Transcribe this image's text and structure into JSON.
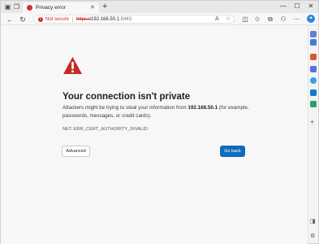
{
  "browser": {
    "tab_title": "Privacy error",
    "new_tab_icon": "+",
    "address": {
      "security_label": "Not secure",
      "scheme": "https://",
      "host": "192.168.50.1",
      "port": ":8443"
    }
  },
  "page": {
    "heading": "Your connection isn't private",
    "desc_before": "Attackers might be trying to steal your information from ",
    "desc_host": "192.168.50.1",
    "desc_after": " (for example, passwords, messages, or credit cards).",
    "error_code": "NET::ERR_CERT_AUTHORITY_INVALID",
    "advanced_label": "Advanced",
    "go_back_label": "Go back"
  },
  "colors": {
    "warning_red": "#c62828",
    "primary_blue": "#0f6cbd"
  },
  "icons": [
    "workspaces-icon",
    "tab-actions-icon",
    "back-icon",
    "refresh-icon",
    "read-aloud-icon",
    "favorites-star-icon",
    "split-screen-icon",
    "collections-icon",
    "extensions-icon",
    "copilot-icon",
    "warning-triangle-icon"
  ]
}
